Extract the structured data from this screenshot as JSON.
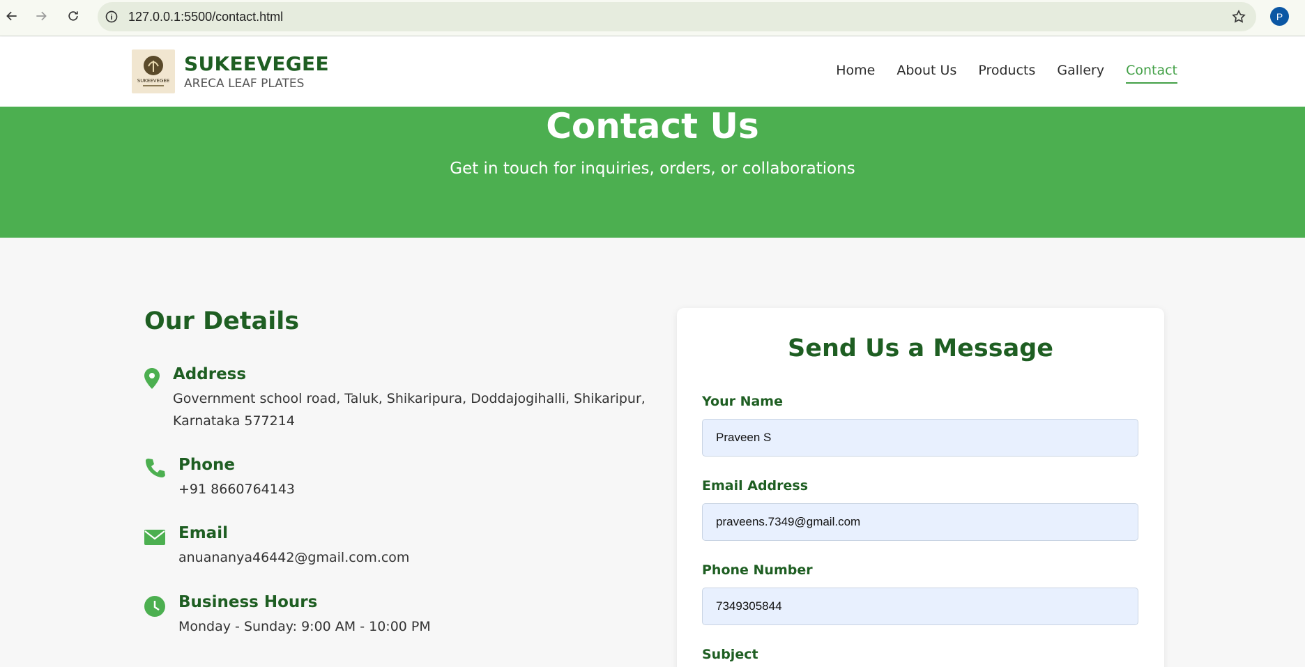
{
  "browser": {
    "url": "127.0.0.1:5500/contact.html",
    "profile_initial": "P"
  },
  "header": {
    "brand_name": "SUKEEVEGEE",
    "brand_tagline": "ARECA LEAF PLATES",
    "logo_text": "SUKEEVEGEE",
    "nav": [
      {
        "label": "Home"
      },
      {
        "label": "About Us"
      },
      {
        "label": "Products"
      },
      {
        "label": "Gallery"
      },
      {
        "label": "Contact",
        "active": true
      }
    ]
  },
  "hero": {
    "title": "Contact Us",
    "subtitle": "Get in touch for inquiries, orders, or collaborations"
  },
  "details": {
    "title": "Our Details",
    "address": {
      "heading": "Address",
      "line1": "Government school road, Taluk, Shikaripura, Doddajogihalli, Shikaripur,",
      "line2": "Karnataka 577214"
    },
    "phone": {
      "heading": "Phone",
      "value": "+91 8660764143"
    },
    "email": {
      "heading": "Email",
      "value": "anuananya46442@gmail.com.com"
    },
    "hours": {
      "heading": "Business Hours",
      "value": "Monday - Sunday: 9:00 AM - 10:00 PM"
    }
  },
  "form": {
    "title": "Send Us a Message",
    "name_label": "Your Name",
    "name_value": "Praveen S",
    "email_label": "Email Address",
    "email_value": "praveens.7349@gmail.com",
    "phone_label": "Phone Number",
    "phone_value": "7349305844",
    "subject_label": "Subject"
  },
  "colors": {
    "brand_green": "#1e5e22",
    "accent_green": "#4caf50",
    "input_bg": "#e8f0fe"
  }
}
